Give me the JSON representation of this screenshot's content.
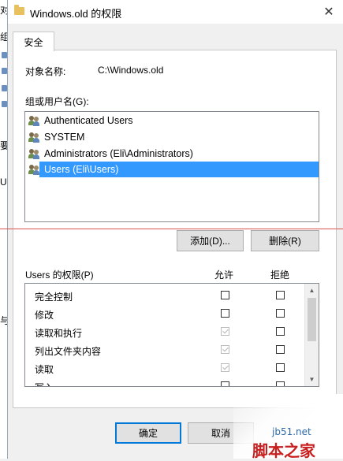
{
  "background_window": {
    "chars": [
      "对",
      "组",
      "要",
      "U:",
      "与"
    ]
  },
  "window": {
    "title": "Windows.old 的权限",
    "close_glyph": "✕"
  },
  "tab": {
    "label": "安全"
  },
  "object": {
    "label": "对象名称:",
    "value": "C:\\Windows.old"
  },
  "group_list": {
    "label": "组或用户名(G):",
    "items": [
      {
        "name": "Authenticated Users",
        "icon": "users-icon",
        "selected": false
      },
      {
        "name": "SYSTEM",
        "icon": "users-icon",
        "selected": false
      },
      {
        "name": "Administrators (Eli\\Administrators)",
        "icon": "users-icon",
        "selected": false
      },
      {
        "name": "Users (Eli\\Users)",
        "icon": "users-icon",
        "selected": true
      }
    ]
  },
  "buttons": {
    "add": "添加(D)...",
    "remove": "删除(R)",
    "ok": "确定",
    "cancel": "取消"
  },
  "permissions": {
    "title": "Users 的权限(P)",
    "allow_header": "允许",
    "deny_header": "拒绝",
    "rows": [
      {
        "name": "完全控制",
        "allow": false,
        "deny": false
      },
      {
        "name": "修改",
        "allow": false,
        "deny": false
      },
      {
        "name": "读取和执行",
        "allow": true,
        "deny": false
      },
      {
        "name": "列出文件夹内容",
        "allow": true,
        "deny": false
      },
      {
        "name": "读取",
        "allow": true,
        "deny": false
      },
      {
        "name": "写入",
        "allow": false,
        "deny": false
      }
    ]
  },
  "watermark": {
    "url": "jb51.net",
    "brand": "脚本之家"
  },
  "colors": {
    "selection": "#3399ff",
    "default_button_border": "#0078d7",
    "annotation_line": "#d9534f",
    "watermark_brand": "#c81e1e"
  }
}
